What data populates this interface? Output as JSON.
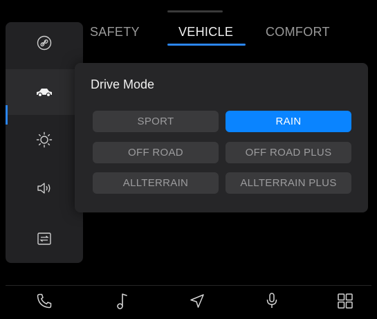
{
  "tabs": [
    {
      "label": "SAFETY",
      "active": false
    },
    {
      "label": "VEHICLE",
      "active": true
    },
    {
      "label": "COMFORT",
      "active": false
    }
  ],
  "sidebar": {
    "items": [
      {
        "icon": "link-icon",
        "active": false
      },
      {
        "icon": "car-icon",
        "active": true
      },
      {
        "icon": "brightness-icon",
        "active": false
      },
      {
        "icon": "speaker-icon",
        "active": false
      },
      {
        "icon": "settings-list-icon",
        "active": false
      }
    ]
  },
  "drive_mode": {
    "title": "Drive Mode",
    "options": [
      "SPORT",
      "RAIN",
      "OFF ROAD",
      "OFF ROAD PLUS",
      "ALLTERRAIN",
      "ALLTERRAIN PLUS"
    ],
    "selected": "RAIN"
  },
  "bottom_bar": {
    "items": [
      "phone-icon",
      "music-icon",
      "navigation-icon",
      "microphone-icon",
      "apps-grid-icon"
    ]
  },
  "colors": {
    "accent": "#0a84ff",
    "underline": "#2b86f2",
    "background": "#000000",
    "card": "#262628"
  }
}
